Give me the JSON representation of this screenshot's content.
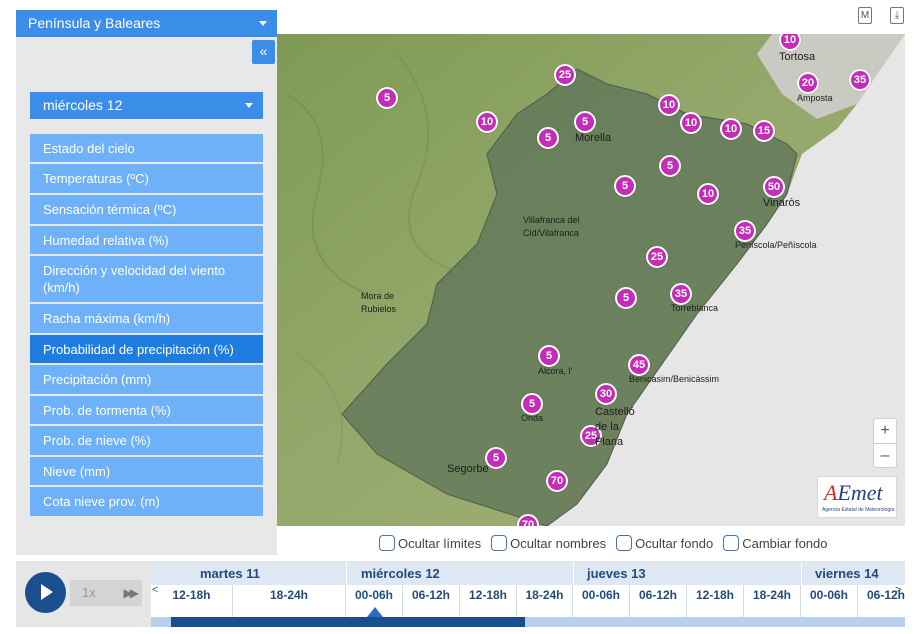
{
  "region": {
    "label": "Península y Baleares"
  },
  "collapse": {
    "glyph": "«"
  },
  "day_select": {
    "label": "miércoles 12"
  },
  "variables": [
    {
      "label": "Estado del cielo",
      "active": false
    },
    {
      "label": "Temperaturas (ºC)",
      "active": false
    },
    {
      "label": "Sensación térmica (ºC)",
      "active": false
    },
    {
      "label": "Humedad relativa (%)",
      "active": false
    },
    {
      "label": "Dirección y velocidad del viento (km/h)",
      "active": false
    },
    {
      "label": "Racha máxima (km/h)",
      "active": false
    },
    {
      "label": "Probabilidad de precipitación (%)",
      "active": true
    },
    {
      "label": "Precipitación (mm)",
      "active": false
    },
    {
      "label": "Prob. de tormenta (%)",
      "active": false
    },
    {
      "label": "Prob. de nieve (%)",
      "active": false
    },
    {
      "label": "Nieve (mm)",
      "active": false
    },
    {
      "label": "Cota nieve prov. (m)",
      "active": false
    }
  ],
  "top_icons": {
    "map_label": "M",
    "download_label": "⤓"
  },
  "map": {
    "markers": [
      "10",
      "25",
      "5",
      "10",
      "5",
      "5",
      "10",
      "10",
      "10",
      "15",
      "20",
      "35",
      "5",
      "5",
      "10",
      "50",
      "35",
      "25",
      "5",
      "35",
      "5",
      "45",
      "30",
      "5",
      "25",
      "5",
      "70",
      "70"
    ],
    "places": [
      "Tortosa",
      "Amposta",
      "Morella",
      "Vinaròs",
      "Villafranca del Cid/Vilafranca",
      "Peníscola/Peñíscola",
      "Mora de Rubielos",
      "Torreblanca",
      "Alcora, l'",
      "Benicasim/Benicàssim",
      "Castelló de la Plana",
      "Onda",
      "Segorbe"
    ],
    "zoom_in": "+",
    "zoom_out": "–"
  },
  "logo": {
    "text_a": "A",
    "text_rest": "Emet",
    "subtitle": "Agencia Estatal de Meteorología"
  },
  "options": [
    {
      "label": "Ocultar límites"
    },
    {
      "label": "Ocultar nombres"
    },
    {
      "label": "Ocultar fondo"
    },
    {
      "label": "Cambiar fondo"
    }
  ],
  "timeline": {
    "speed": "1x",
    "ff": "▶▶",
    "days": [
      "martes 11",
      "miércoles 12",
      "jueves 13",
      "viernes 14"
    ],
    "slots": [
      "12-18h",
      "18-24h",
      "00-06h",
      "06-12h",
      "12-18h",
      "18-24h",
      "00-06h",
      "06-12h",
      "12-18h",
      "18-24h",
      "00-06h",
      "06-12h"
    ],
    "current_slot": "00-06h",
    "arrow_left": "<",
    "arrow_right": ">"
  },
  "colors": {
    "accent": "#3b8ee8",
    "active_item": "#1f7ce0",
    "item": "#6fb1f8",
    "marker": "#c42db8",
    "timeline_dark": "#1a4f8f"
  }
}
